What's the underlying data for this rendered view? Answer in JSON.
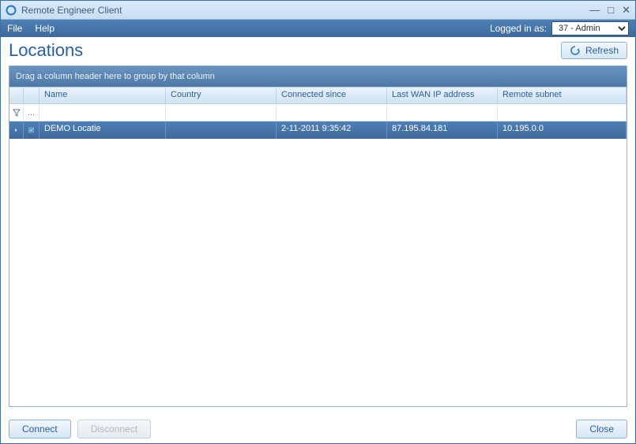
{
  "app": {
    "title": "Remote Engineer Client"
  },
  "menu": {
    "file": "File",
    "help": "Help",
    "logged_in_label": "Logged in as:",
    "user_selected": "37 - Admin"
  },
  "page": {
    "title": "Locations",
    "refresh_label": "Refresh"
  },
  "grid": {
    "group_hint": "Drag a column header here to group by that column",
    "columns": {
      "name": "Name",
      "country": "Country",
      "connected_since": "Connected since",
      "last_wan": "Last WAN IP address",
      "remote_subnet": "Remote subnet"
    },
    "filter_placeholder": "...",
    "rows": [
      {
        "name": "DEMO Locatie",
        "country": "",
        "connected_since": "2-11-2011 9:35:42",
        "last_wan": "87.195.84.181",
        "remote_subnet": "10.195.0.0"
      }
    ]
  },
  "footer": {
    "connect": "Connect",
    "disconnect": "Disconnect",
    "close": "Close"
  }
}
